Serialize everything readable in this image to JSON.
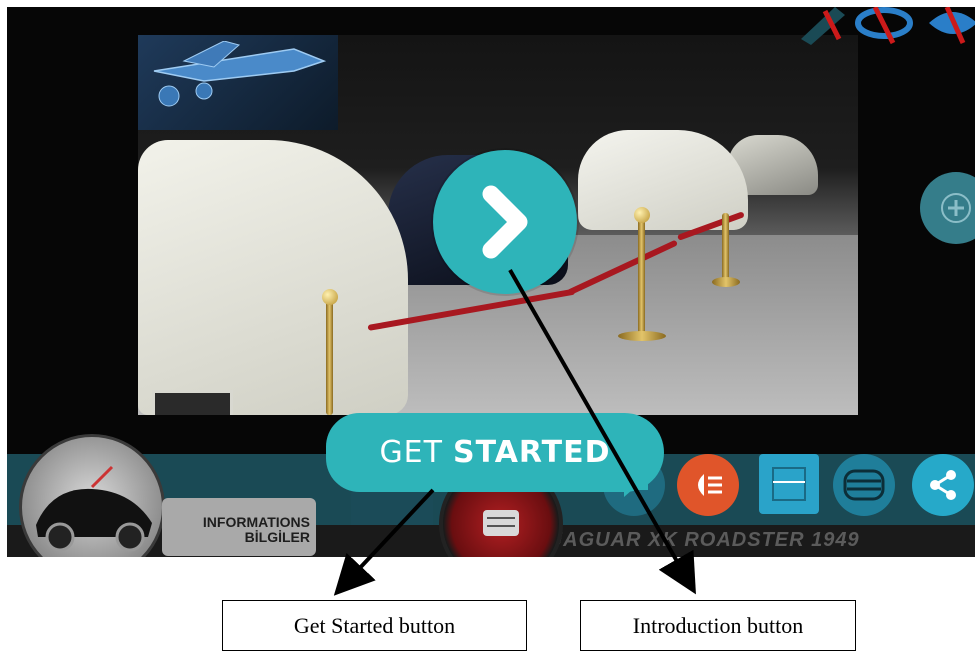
{
  "app": {
    "get_started": {
      "word1": "GET",
      "word2": "STARTED"
    },
    "info_button": {
      "line1": "INFORMATIONS",
      "line2": "BİLGİLER"
    },
    "model_name": "JAGUAR XK ROADSTER 1949",
    "top_icons": [
      "pen-icon",
      "rotate-icon",
      "eye-icon"
    ],
    "side_button": "plus-icon",
    "toolbar_icons": [
      "chat-icon",
      "headlight-icon",
      "door-icon",
      "grille-icon",
      "share-icon"
    ],
    "colors": {
      "accent": "#2eb4b9",
      "toolbar": "#1a4a55",
      "badge_red": "#b21f22",
      "headlight_orange": "#e0552a"
    }
  },
  "annotations": {
    "left_label": "Get Started button",
    "right_label": "Introduction button"
  }
}
